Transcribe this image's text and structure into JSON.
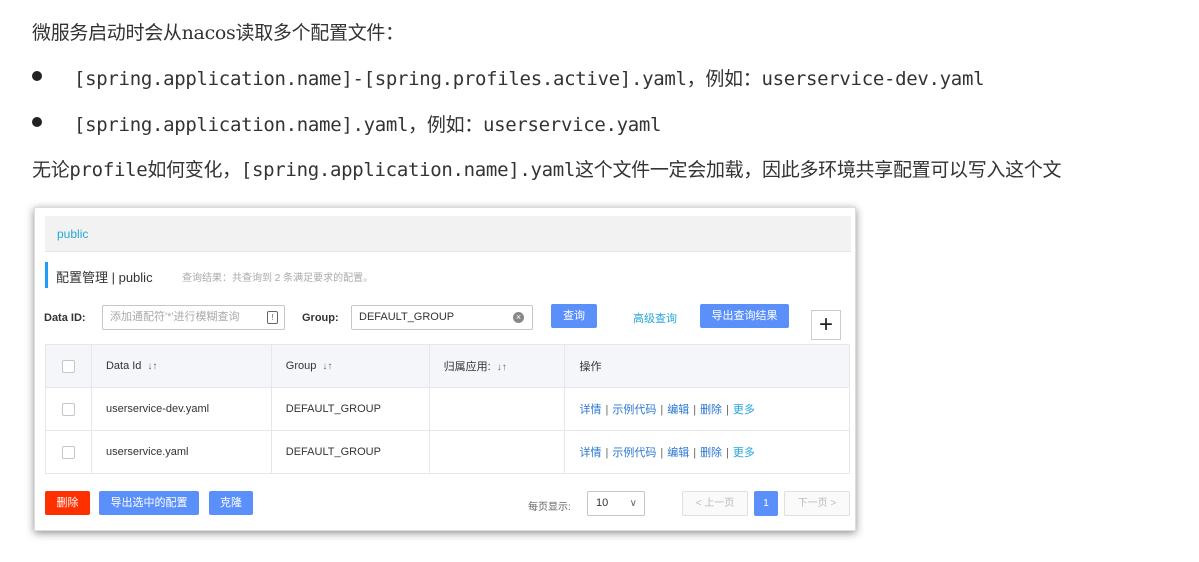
{
  "doc": {
    "intro": "微服务启动时会从nacos读取多个配置文件：",
    "bullets": [
      "[spring.application.name]-[spring.profiles.active].yaml，例如：userservice-dev.yaml",
      "[spring.application.name].yaml，例如：userservice.yaml"
    ],
    "conclusion": "无论profile如何变化，[spring.application.name].yaml这个文件一定会加载，因此多环境共享配置可以写入这个文"
  },
  "nacos": {
    "namespace_tab": "public",
    "page_title": "配置管理 | public",
    "result_text": "查询结果：共查询到 2 条满足要求的配置。",
    "search": {
      "data_id_label": "Data ID:",
      "data_id_placeholder": "添加通配符'*'进行模糊查询",
      "group_label": "Group:",
      "group_value": "DEFAULT_GROUP",
      "query_button": "查询",
      "advanced_link": "高级查询",
      "export_results_button": "导出查询结果",
      "add_button": "+"
    },
    "table": {
      "headers": [
        "Data Id",
        "Group",
        "归属应用:",
        "操作"
      ],
      "rows": [
        {
          "data_id": "userservice-dev.yaml",
          "group": "DEFAULT_GROUP",
          "app": ""
        },
        {
          "data_id": "userservice.yaml",
          "group": "DEFAULT_GROUP",
          "app": ""
        }
      ],
      "ops": {
        "detail": "详情",
        "sample_code": "示例代码",
        "edit": "编辑",
        "delete": "删除",
        "more": "更多",
        "separator": "|"
      }
    },
    "footer": {
      "delete_button": "删除",
      "export_selected_button": "导出选中的配置",
      "clone_button": "克隆",
      "page_size_label": "每页显示:",
      "page_size_value": "10",
      "prev_page": "上一页",
      "current_page": "1",
      "next_page": "下一页"
    },
    "colors": {
      "primary": "#5b8ff9",
      "danger": "#ff3000",
      "link": "#26a6d9"
    }
  }
}
